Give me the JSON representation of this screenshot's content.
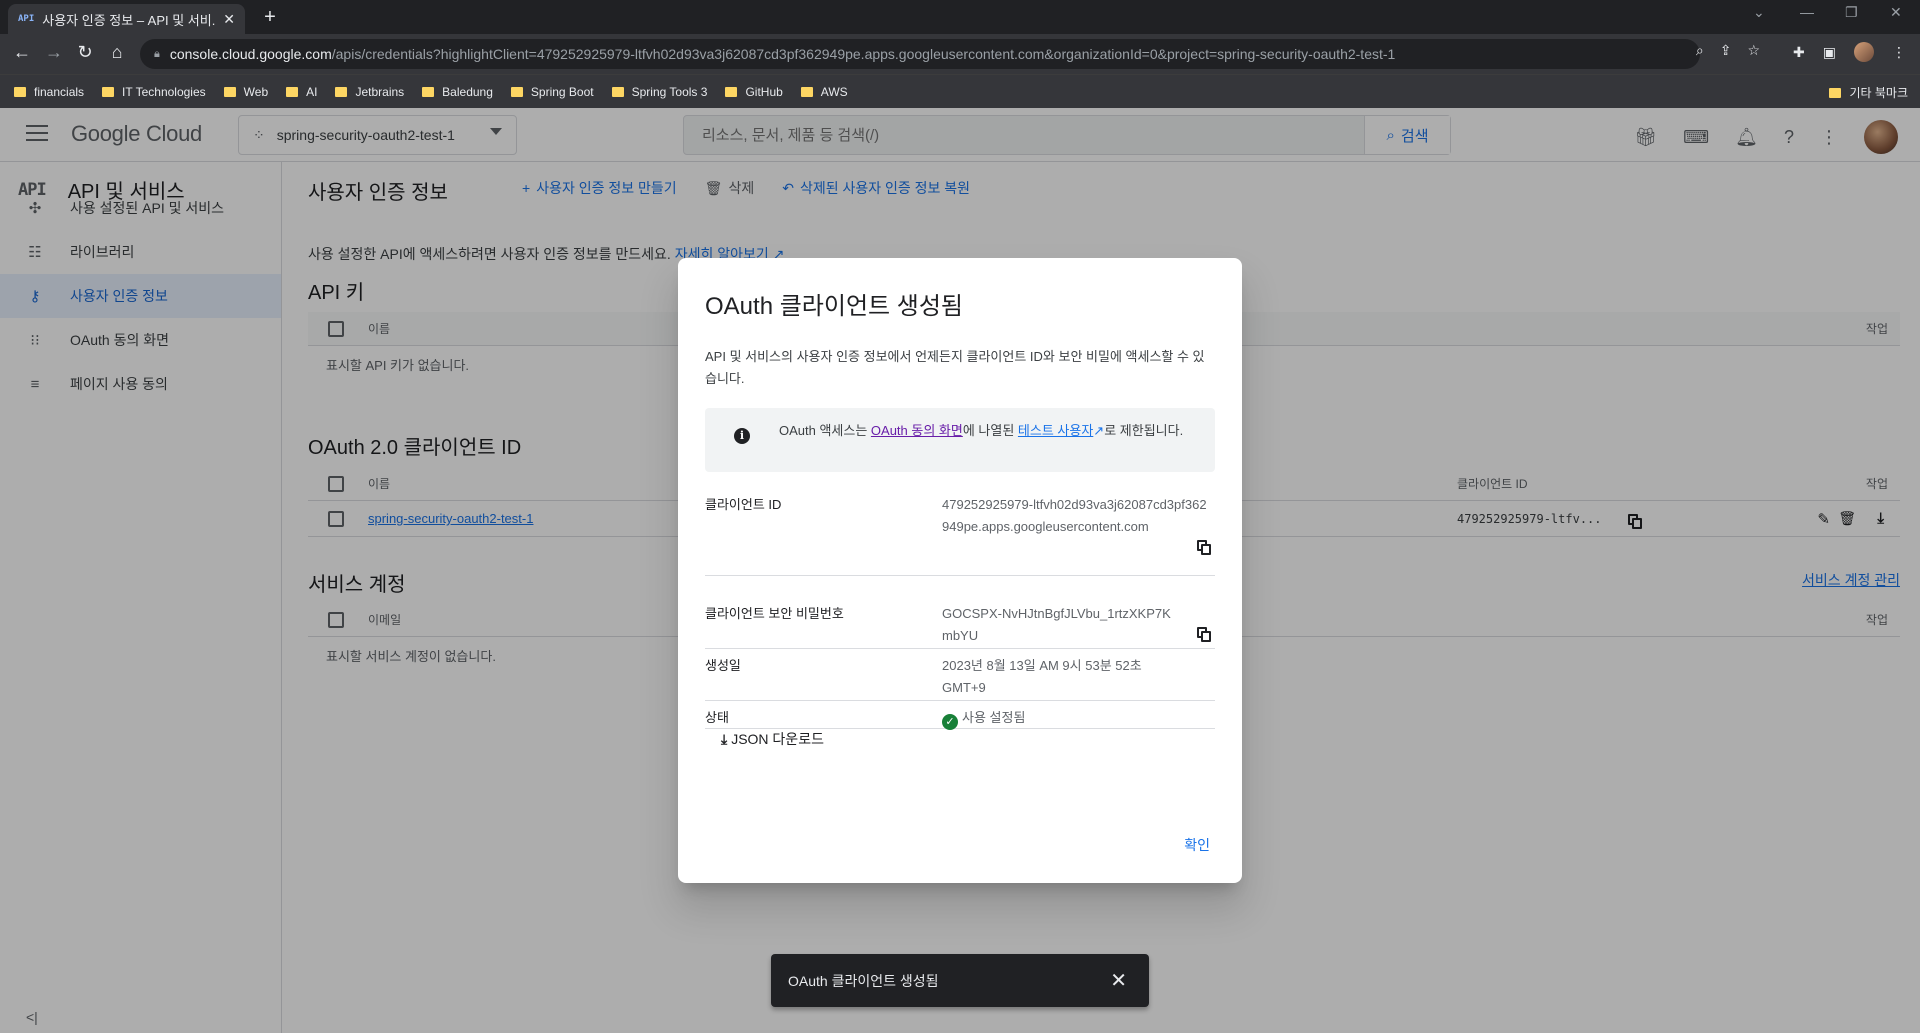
{
  "browser": {
    "tab_title": "사용자 인증 정보 – API 및 서비...",
    "tab_favicon": "API",
    "url_host": "console.cloud.google.com",
    "url_path": "/apis/credentials?highlightClient=479252925979-ltfvh02d93va3j62087cd3pf362949pe.apps.googleusercontent.com&organizationId=0&project=spring-security-oauth2-test-1",
    "bookmarks": [
      "financials",
      "IT Technologies",
      "Web",
      "AI",
      "Jetbrains",
      "Baledung",
      "Spring Boot",
      "Spring Tools 3",
      "GitHub",
      "AWS"
    ],
    "other_bookmarks": "기타 북마크"
  },
  "header": {
    "logo_google": "Google",
    "logo_cloud": "Cloud",
    "project": "spring-security-oauth2-test-1",
    "search_placeholder": "리소스, 문서, 제품 등 검색(/)",
    "search_button": "검색"
  },
  "sidebar": {
    "icon_text": "API",
    "title": "API 및 서비스",
    "items": [
      {
        "label": "사용 설정된 API 및 서비스",
        "icon": "hub-icon"
      },
      {
        "label": "라이브러리",
        "icon": "library-icon"
      },
      {
        "label": "사용자 인증 정보",
        "icon": "key-icon"
      },
      {
        "label": "OAuth 동의 화면",
        "icon": "consent-icon"
      },
      {
        "label": "페이지 사용 동의",
        "icon": "settings-list-icon"
      }
    ]
  },
  "main": {
    "title": "사용자 인증 정보",
    "actions": {
      "create": "사용자 인증 정보 만들기",
      "delete": "삭제",
      "restore": "삭제된 사용자 인증 정보 복원"
    },
    "description": "사용 설정한 API에 액세스하려면 사용자 인증 정보를 만드세요.",
    "learn_more": "자세히 알아보기",
    "api_keys": {
      "title": "API 키",
      "col_name": "이름",
      "col_action": "작업",
      "empty": "표시할 API 키가 없습니다."
    },
    "oauth": {
      "title": "OAuth 2.0 클라이언트 ID",
      "col_name": "이름",
      "col_client": "클라이언트 ID",
      "col_action": "작업",
      "row_name": "spring-security-oauth2-test-1",
      "row_client": "479252925979-ltfv..."
    },
    "service_accounts": {
      "title": "서비스 계정",
      "manage": "서비스 계정 관리",
      "col_email": "이메일",
      "col_action": "작업",
      "empty": "표시할 서비스 계정이 없습니다."
    }
  },
  "dialog": {
    "title": "OAuth 클라이언트 생성됨",
    "description": "API 및 서비스의 사용자 인증 정보에서 언제든지 클라이언트 ID와 보안 비밀에 액세스할 수 있습니다.",
    "info_pre": "OAuth 액세스는 ",
    "info_link1": "OAuth 동의 화면",
    "info_mid": "에 나열된 ",
    "info_link2": "테스트 사용자",
    "info_post": "로 제한됩니다.",
    "client_id_label": "클라이언트 ID",
    "client_id": "479252925979-ltfvh02d93va3j62087cd3pf362949pe.apps.googleusercontent.com",
    "secret_label": "클라이언트 보안 비밀번호",
    "secret": "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",
    "created_label": "생성일",
    "created": "2023년 8월 13일 AM 9시 53분 52초 GMT+9",
    "status_label": "상태",
    "status": "사용 설정됨",
    "json_download": "JSON 다운로드",
    "ok": "확인"
  },
  "snackbar": {
    "message": "OAuth 클라이언트 생성됨"
  },
  "colors": {
    "accent": "#1a73e8",
    "status_ok": "#188038"
  }
}
